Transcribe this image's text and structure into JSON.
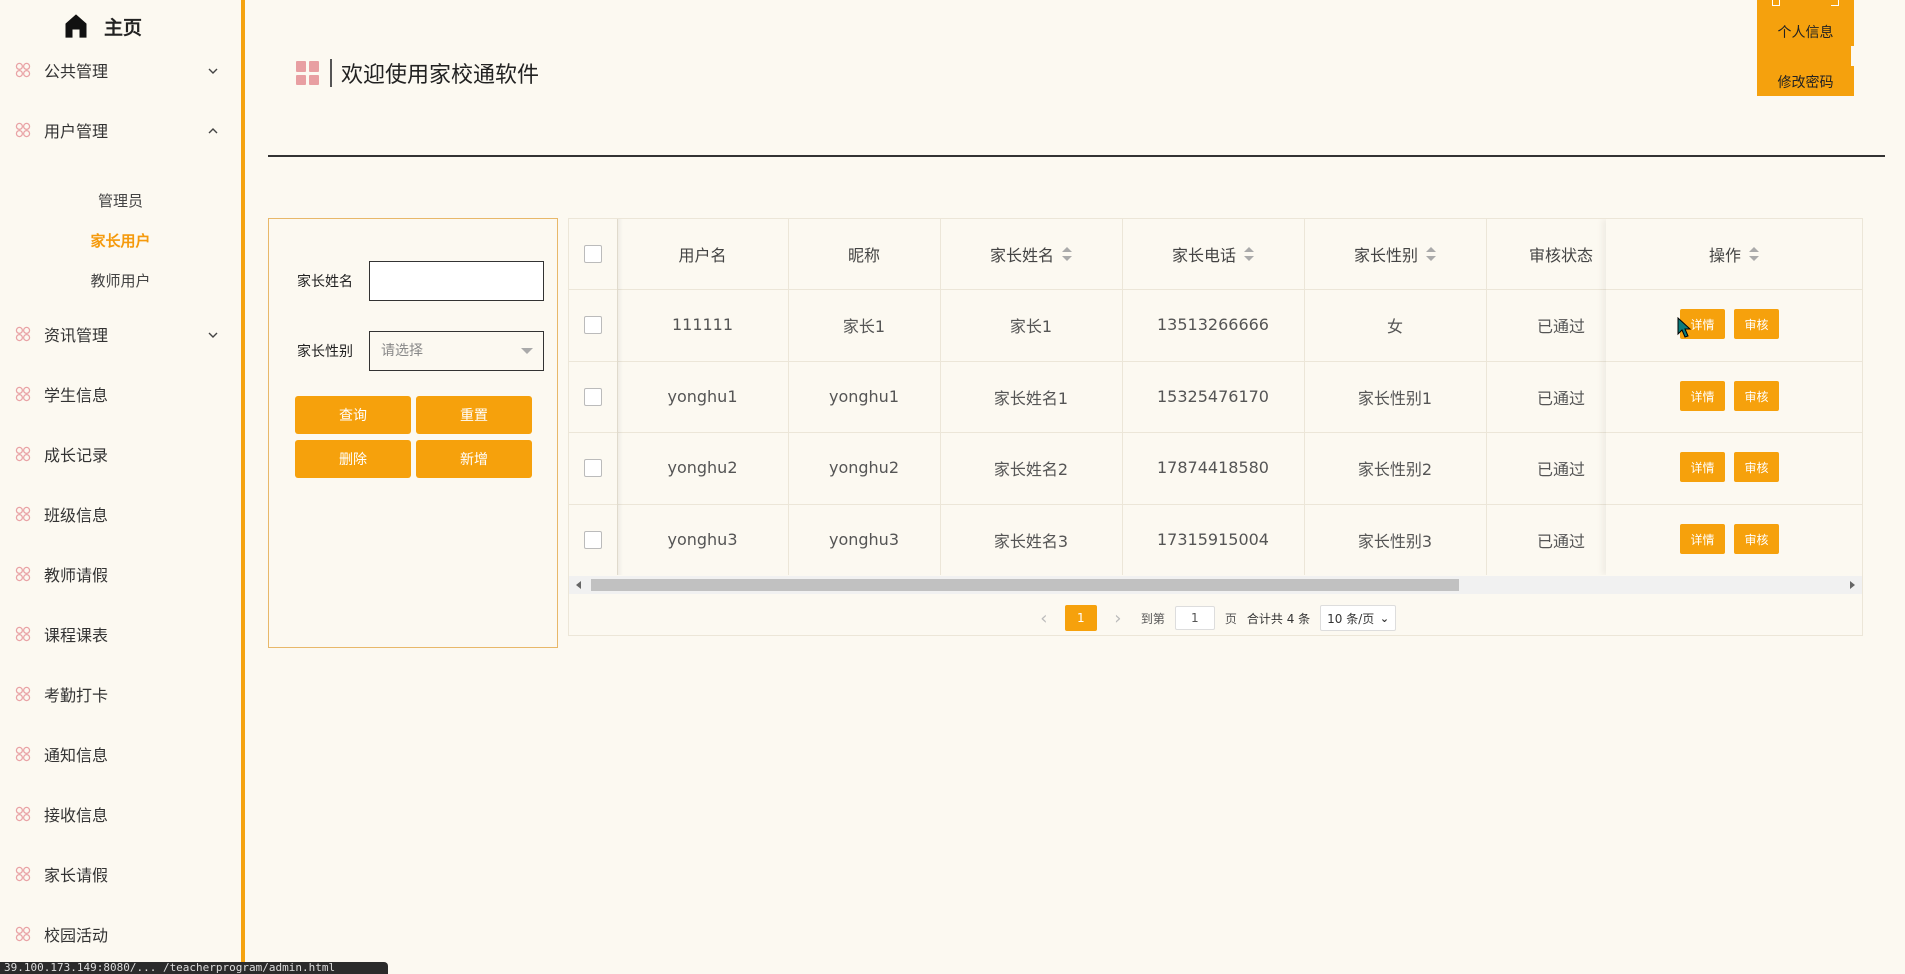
{
  "sidebar": {
    "home_label": "主页",
    "items": [
      {
        "label": "公共管理",
        "expanded": false
      },
      {
        "label": "用户管理",
        "expanded": true
      },
      {
        "label": "资讯管理",
        "expanded": false
      },
      {
        "label": "学生信息"
      },
      {
        "label": "成长记录"
      },
      {
        "label": "班级信息"
      },
      {
        "label": "教师请假"
      },
      {
        "label": "课程课表"
      },
      {
        "label": "考勤打卡"
      },
      {
        "label": "通知信息"
      },
      {
        "label": "接收信息"
      },
      {
        "label": "家长请假"
      },
      {
        "label": "校园活动"
      }
    ],
    "submenu": [
      {
        "label": "管理员",
        "active": false
      },
      {
        "label": "家长用户",
        "active": true
      },
      {
        "label": "教师用户",
        "active": false
      }
    ]
  },
  "header": {
    "title": "欢迎使用家校通软件"
  },
  "user_menu": {
    "profile": "个人信息",
    "change_password": "修改密码"
  },
  "filter": {
    "name_label": "家长姓名",
    "name_value": "",
    "gender_label": "家长性别",
    "gender_placeholder": "请选择",
    "buttons": {
      "search": "查询",
      "reset": "重置",
      "delete": "删除",
      "add": "新增"
    }
  },
  "table": {
    "columns": [
      "用户名",
      "昵称",
      "家长姓名",
      "家长电话",
      "家长性别",
      "审核状态",
      "操作"
    ],
    "rows": [
      {
        "username": "111111",
        "nickname": "家长1",
        "name": "家长1",
        "phone": "13513266666",
        "gender": "女",
        "status": "已通过"
      },
      {
        "username": "yonghu1",
        "nickname": "yonghu1",
        "name": "家长姓名1",
        "phone": "15325476170",
        "gender": "家长性别1",
        "status": "已通过"
      },
      {
        "username": "yonghu2",
        "nickname": "yonghu2",
        "name": "家长姓名2",
        "phone": "17874418580",
        "gender": "家长性别2",
        "status": "已通过"
      },
      {
        "username": "yonghu3",
        "nickname": "yonghu3",
        "name": "家长姓名3",
        "phone": "17315915004",
        "gender": "家长性别3",
        "status": "已通过"
      }
    ],
    "actions": {
      "detail": "详情",
      "review": "审核"
    }
  },
  "pagination": {
    "current_page": "1",
    "goto_label": "到第",
    "goto_value": "1",
    "page_unit": "页",
    "total_text": "合计共 4 条",
    "page_size": "10 条/页"
  },
  "status_bar": {
    "text": "39.100.173.149:8080/... /teacherprogram/admin.html"
  },
  "colors": {
    "accent": "#f6a10c",
    "background": "#fcf9f1",
    "icon_pink": "#e89fa2"
  }
}
